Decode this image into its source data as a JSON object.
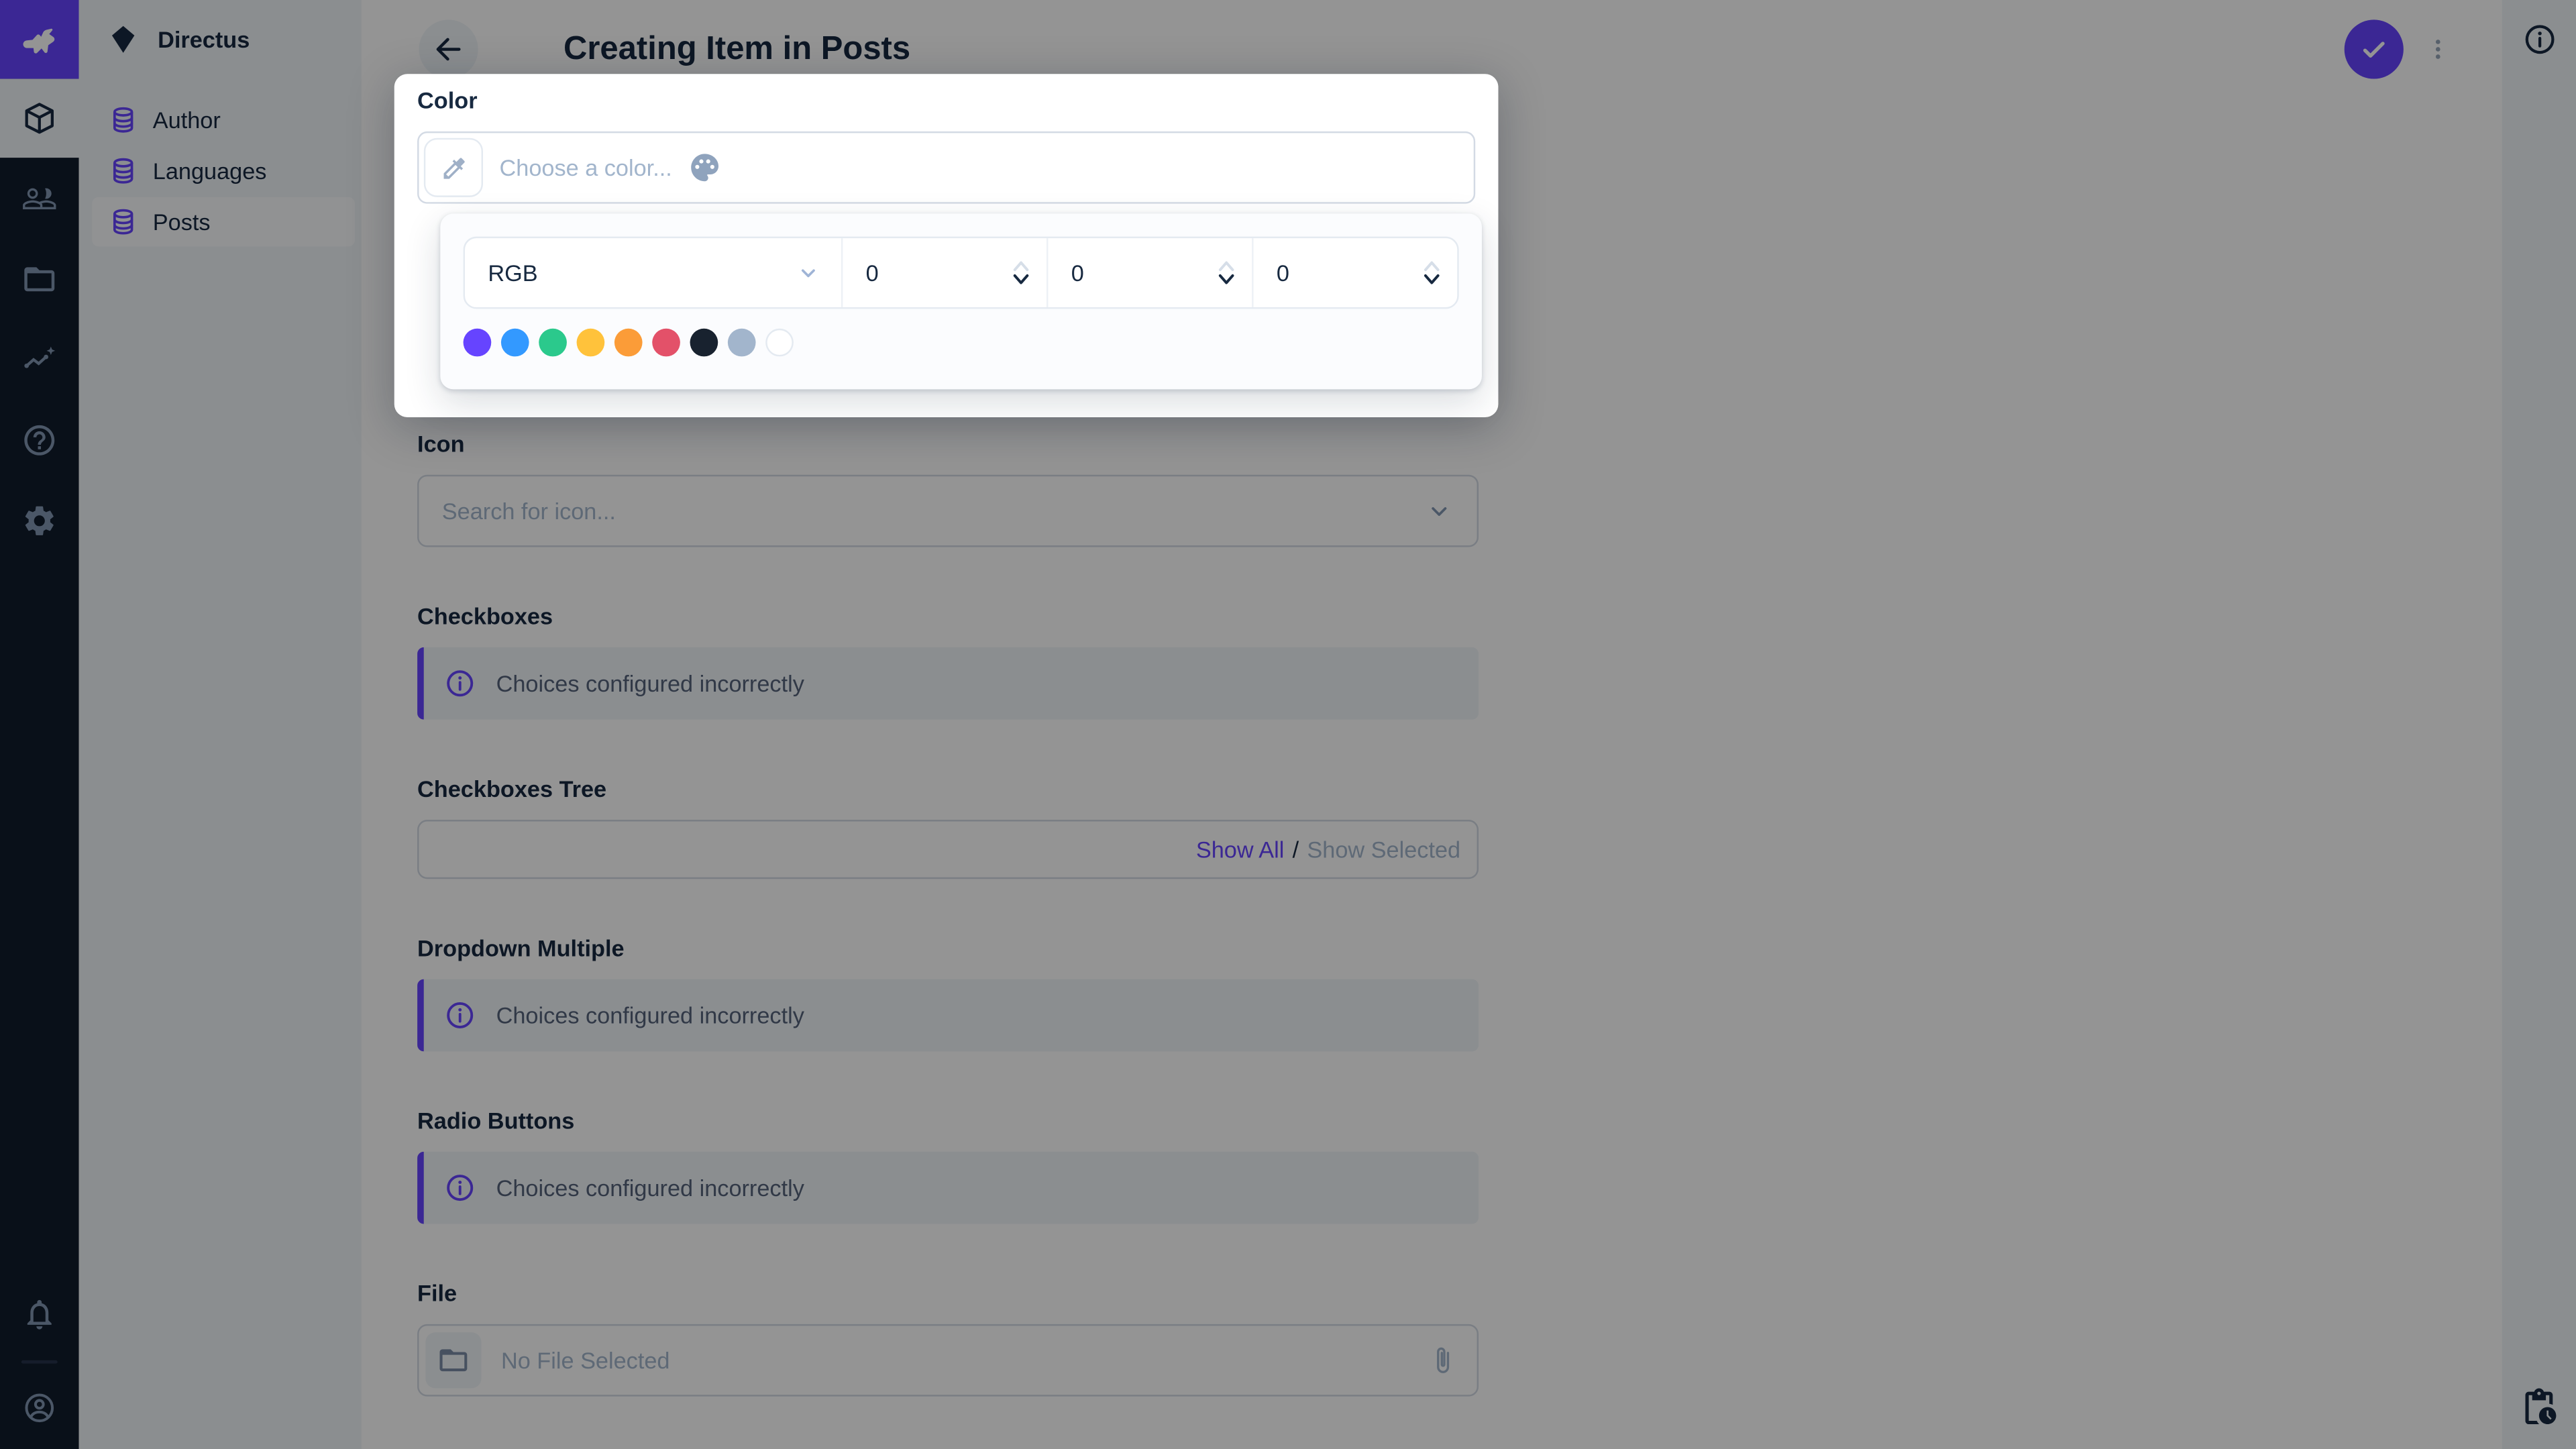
{
  "colors": {
    "accent": "#6644FF",
    "dark": "#172940",
    "muted": "#A2B5CC",
    "module_bar_bg": "#111C2B",
    "background_subdued": "#F0F4F9"
  },
  "nav": {
    "project_name": "Directus",
    "items": [
      {
        "label": "Author",
        "active": false
      },
      {
        "label": "Languages",
        "active": false
      },
      {
        "label": "Posts",
        "active": true
      }
    ]
  },
  "header": {
    "title": "Creating Item in Posts"
  },
  "color_picker": {
    "label": "Color",
    "placeholder": "Choose a color...",
    "mode": "RGB",
    "channels": [
      "0",
      "0",
      "0"
    ],
    "swatches": [
      {
        "name": "purple",
        "hex": "#6644FF"
      },
      {
        "name": "blue",
        "hex": "#3399FF"
      },
      {
        "name": "green",
        "hex": "#2BC98C"
      },
      {
        "name": "yellow",
        "hex": "#FFC23B"
      },
      {
        "name": "orange",
        "hex": "#FB9C38"
      },
      {
        "name": "red",
        "hex": "#E35169"
      },
      {
        "name": "black",
        "hex": "#18222F"
      },
      {
        "name": "gray",
        "hex": "#A2B5CC"
      },
      {
        "name": "white",
        "hex": "#FFFFFF"
      }
    ]
  },
  "form": {
    "icon": {
      "label": "Icon",
      "placeholder": "Search for icon..."
    },
    "checkboxes": {
      "label": "Checkboxes",
      "notice": "Choices configured incorrectly"
    },
    "checkboxes_tree": {
      "label": "Checkboxes Tree",
      "show_all": "Show All",
      "separator": "/",
      "show_selected": "Show Selected"
    },
    "dropdown_multiple": {
      "label": "Dropdown Multiple",
      "notice": "Choices configured incorrectly"
    },
    "radio_buttons": {
      "label": "Radio Buttons",
      "notice": "Choices configured incorrectly"
    },
    "file": {
      "label": "File",
      "placeholder": "No File Selected"
    }
  }
}
